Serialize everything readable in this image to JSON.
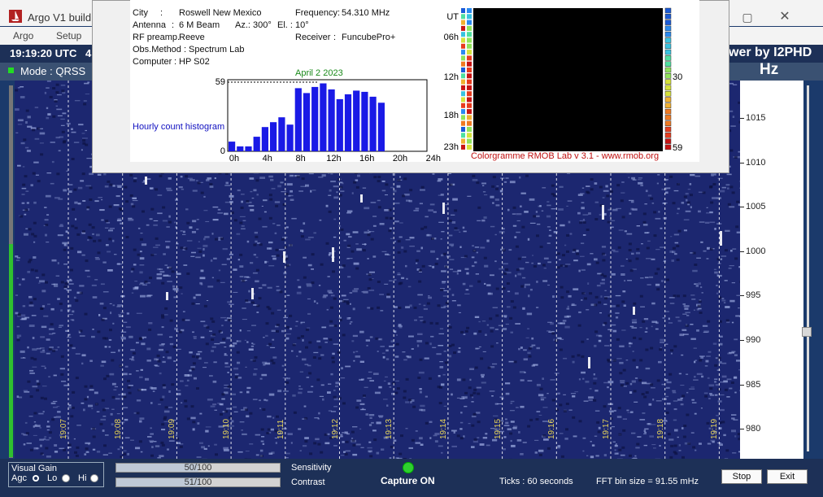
{
  "app": {
    "title": "Argo V1 build",
    "menus": [
      "Argo",
      "Setup"
    ],
    "utc_time": "19:19:20 UTC",
    "utc_extra": "4",
    "mode": "Mode : QRSS",
    "brand": "wer by I2PHD",
    "unit": "Hz"
  },
  "waterfall": {
    "time_labels": [
      "19:07",
      "19:08",
      "19:09",
      "19:10",
      "19:11",
      "19:12",
      "19:13",
      "19:14",
      "19:15",
      "19:16",
      "19:17",
      "19:18",
      "19:19"
    ],
    "freq_labels": [
      "1015",
      "1010",
      "1005",
      "1000",
      "995",
      "990",
      "985",
      "980"
    ]
  },
  "controls": {
    "visual_gain_label": "Visual Gain",
    "agc_label": "Agc",
    "lo_label": "Lo",
    "hi_label": "Hi",
    "sensitivity": {
      "label": "Sensitivity",
      "value": 50,
      "max": 100,
      "text": "50/100"
    },
    "contrast": {
      "label": "Contrast",
      "value": 51,
      "max": 100,
      "text": "51/100"
    },
    "capture_status": "Capture ON",
    "ticks": "Ticks   : 60 seconds",
    "fft_bin": "FFT bin size = 91.55 mHz",
    "stop_label": "Stop",
    "exit_label": "Exit"
  },
  "rmob": {
    "city_label": "City",
    "city": "Roswell New Mexico",
    "antenna_label": "Antenna",
    "antenna": "6 M Beam",
    "az": "Az.: 300°",
    "el": "El. : 10°",
    "rf_label": "RF preamp.",
    "rf": "Reeve",
    "obs_label": "Obs.Method",
    "obs": "Spectrum Lab",
    "computer_label": "Computer",
    "computer": "HP S02",
    "frequency_label": "Frequency",
    "frequency": "54.310 MHz",
    "receiver_label": "Receiver",
    "receiver": "FuncubePro+",
    "histogram_title": "Hourly count histogram",
    "date": "April 2 2023",
    "colorgramme_title": "Colorgramme RMOB Lab v 3.1 - www.rmob.org",
    "cg_hour_labels": [
      "UT",
      "06h",
      "12h",
      "18h",
      "23h"
    ],
    "cg_scale_labels": [
      "30",
      "59"
    ]
  },
  "chart_data": {
    "type": "bar",
    "title": "Hourly count histogram",
    "categories": [
      "0h",
      "1h",
      "2h",
      "3h",
      "4h",
      "5h",
      "6h",
      "7h",
      "8h",
      "9h",
      "10h",
      "11h",
      "12h",
      "13h",
      "14h",
      "15h",
      "16h",
      "17h",
      "18h",
      "19h",
      "20h",
      "21h",
      "22h",
      "23h"
    ],
    "x_tick_labels": [
      "0h",
      "4h",
      "8h",
      "12h",
      "16h",
      "20h",
      "24h"
    ],
    "values": [
      8,
      4,
      4,
      12,
      20,
      24,
      28,
      22,
      52,
      48,
      53,
      56,
      51,
      43,
      47,
      50,
      49,
      45,
      40,
      0,
      0,
      0,
      0,
      0
    ],
    "ylim": [
      0,
      59
    ],
    "y_tick_labels": [
      "0",
      "59"
    ],
    "color": "#1a1ae6",
    "legend": "none"
  }
}
